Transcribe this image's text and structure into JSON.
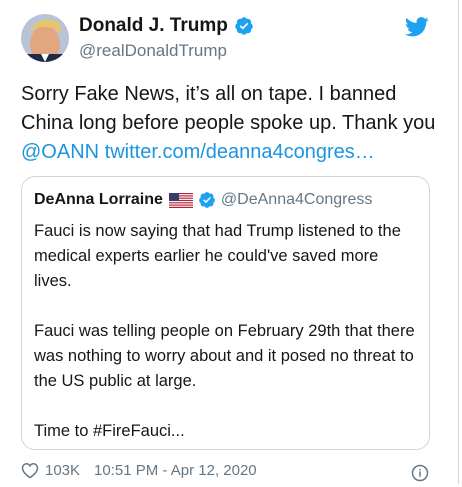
{
  "tweet": {
    "author_name": "Donald J. Trump",
    "author_handle": "@realDonaldTrump",
    "text_before": "Sorry Fake News, it’s all on tape. I banned China long before people spoke up. Thank you ",
    "mention": "@OANN",
    "link_text": "twitter.com/deanna4congres…"
  },
  "quoted_tweet": {
    "author_name": "DeAnna Lorraine",
    "author_handle": "@DeAnna4Congress",
    "paragraphs": [
      "Fauci is now saying that had Trump listened to the medical experts earlier he could've saved more lives.",
      "Fauci was telling people on February 29th that there was nothing to worry about and it posed no threat to the US public at large.",
      "Time to #FireFauci..."
    ]
  },
  "footer": {
    "likes": "103K",
    "timestamp": "10:51 PM - Apr 12, 2020"
  },
  "colors": {
    "link": "#1b95e0",
    "verified": "#1da1f2",
    "secondary_text": "#657786"
  },
  "icons": [
    "verified-badge-icon",
    "twitter-bird-icon",
    "us-flag-icon",
    "heart-icon",
    "info-icon"
  ]
}
